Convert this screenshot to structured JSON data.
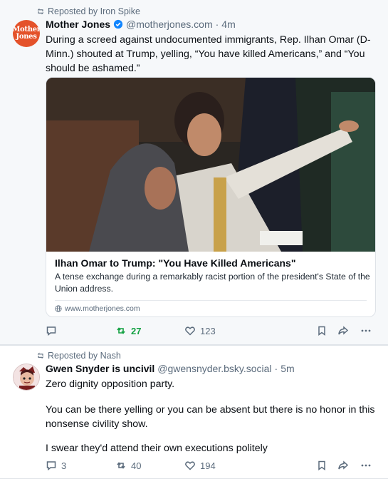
{
  "colors": {
    "reposted_green": "#13a142",
    "muted": "#5b6b7c",
    "verified_blue": "#1185fe",
    "mj_red": "#e4522a"
  },
  "posts": [
    {
      "repost_label": "Reposted by Iron Spike",
      "avatar_lines": [
        "Mother",
        "Jones"
      ],
      "author_name": "Mother Jones",
      "verified": true,
      "handle": "@motherjones.com",
      "separator": "·",
      "time": "4m",
      "text": "During a screed against undocumented immigrants, Rep. Ilhan Omar (D-Minn.) shouted at Trump, yelling, “You have killed Americans,” and “You should be ashamed.”",
      "card": {
        "title": "Ilhan Omar to Trump: \"You Have Killed Americans\"",
        "description": "A tense exchange during a remarkably racist portion of the president's State of the Union address.",
        "domain": "www.motherjones.com"
      },
      "actions": {
        "reply_count": "",
        "repost_count": "27",
        "like_count": "123",
        "reposted": true
      }
    },
    {
      "repost_label": "Reposted by Nash",
      "author_name": "Gwen Snyder is uncivil",
      "handle": "@gwensnyder.bsky.social",
      "separator": "·",
      "time": "5m",
      "paragraphs": [
        "Zero dignity opposition party.",
        "You can be there yelling or you can be absent but there is no honor in this nonsense civility show.",
        "I swear they'd attend their own executions politely"
      ],
      "actions": {
        "reply_count": "3",
        "repost_count": "40",
        "like_count": "194",
        "reposted": false
      }
    }
  ]
}
